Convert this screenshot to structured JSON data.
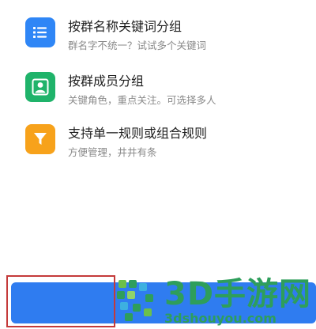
{
  "features": [
    {
      "icon": "list-icon",
      "color": "#2f86f6",
      "title": "按群名称关键词分组",
      "description": "群名字不统一？试试多个关键词"
    },
    {
      "icon": "person-icon",
      "color": "#1fb36a",
      "title": "按群成员分组",
      "description": "关键角色，重点关注。可选择多人"
    },
    {
      "icon": "filter-icon",
      "color": "#f7a21b",
      "title": "支持单一规则或组合规则",
      "description": "方便管理，井井有条"
    }
  ],
  "primary_button": {
    "color": "#2f7cf0"
  },
  "watermark": {
    "brand": "3D手游网",
    "domain": "3dshouyou.com",
    "color": "#2e9e5b"
  }
}
